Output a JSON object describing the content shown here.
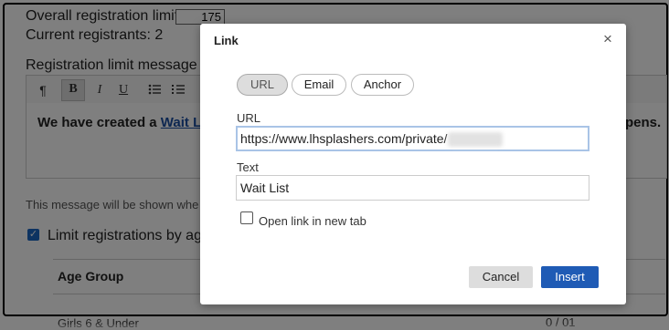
{
  "background": {
    "overall_limit_label": "Overall registration limit",
    "overall_limit_value": "175",
    "current_registrants_label": "Current registrants: 2",
    "limit_message_label": "Registration limit message",
    "editor_text_prefix": "We have created a ",
    "editor_link_text": "Wait L",
    "editor_text_suffix": "pens.",
    "note": "This message will be shown whe",
    "limit_by_age_label": "Limit registrations by age",
    "age_group_header": "Age Group",
    "bottom_row_label": "Girls 6 & Under",
    "bottom_row_ctrl": "0 /  01",
    "toolbar": {
      "paragraph": "¶",
      "bold": "B",
      "italic": "I",
      "underline": "U"
    }
  },
  "dialog": {
    "title": "Link",
    "close_icon": "×",
    "tabs": [
      {
        "label": "URL",
        "active": true
      },
      {
        "label": "Email",
        "active": false
      },
      {
        "label": "Anchor",
        "active": false
      }
    ],
    "url_label": "URL",
    "url_value": "https://www.lhsplashers.com/private/",
    "text_label": "Text",
    "text_value": "Wait List",
    "new_tab_label": "Open link in new tab",
    "new_tab_checked": false,
    "cancel_label": "Cancel",
    "insert_label": "Insert"
  },
  "colors": {
    "primary": "#1f5bb5",
    "overlay": "rgba(0,0,0,0.5)"
  }
}
